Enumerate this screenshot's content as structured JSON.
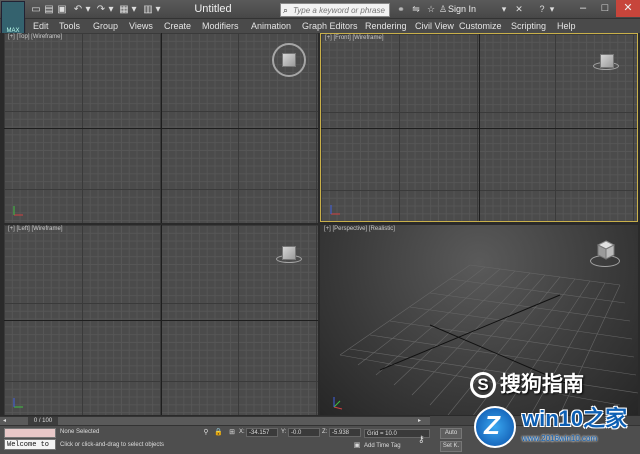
{
  "titlebar": {
    "app_logo_text": "MAX",
    "doc_title": "Untitled",
    "search_placeholder": "Type a keyword or phrase",
    "sign_in": "Sign In",
    "help_symbol": "?",
    "quick_access": [
      "new-icon",
      "open-icon",
      "save-icon",
      "undo-icon",
      "redo-icon",
      "project-icon"
    ],
    "window_controls": [
      "–",
      "□",
      "✕"
    ]
  },
  "menu": {
    "items": [
      "Edit",
      "Tools",
      "Group",
      "Views",
      "Create",
      "Modifiers",
      "Animation",
      "Graph Editors",
      "Rendering",
      "Civil View",
      "Customize",
      "Scripting",
      "Help"
    ]
  },
  "viewports": {
    "top_label": "[+] [Top] [Wireframe]",
    "front_label": "[+] [Front] [Wireframe]",
    "left_label": "[+] [Left] [Wireframe]",
    "persp_label": "[+] [Perspective] [Realistic]"
  },
  "timeline": {
    "frame_label": "0 / 100"
  },
  "status": {
    "welcome": "Welcome to",
    "selection": "None Selected",
    "prompt": "Click or click-and-drag to select objects",
    "x_label": "X:",
    "x_value": "-34.157",
    "y_label": "Y:",
    "y_value": "-0.0",
    "z_label": "Z:",
    "z_value": "-5.938",
    "grid": "Grid = 10.0",
    "add_time_tag": "Add Time Tag",
    "auto_key": "Auto",
    "set_key": "Set K."
  },
  "watermark": {
    "search_brand": "搜狗指南",
    "search_letter": "S",
    "win_brand": "win10之家",
    "win_url": "www.2016win10.com"
  },
  "colors": {
    "active_viewport_border": "#c9b04a",
    "axis_x": "#d04040",
    "axis_y": "#40c040",
    "axis_z": "#4060e0"
  }
}
